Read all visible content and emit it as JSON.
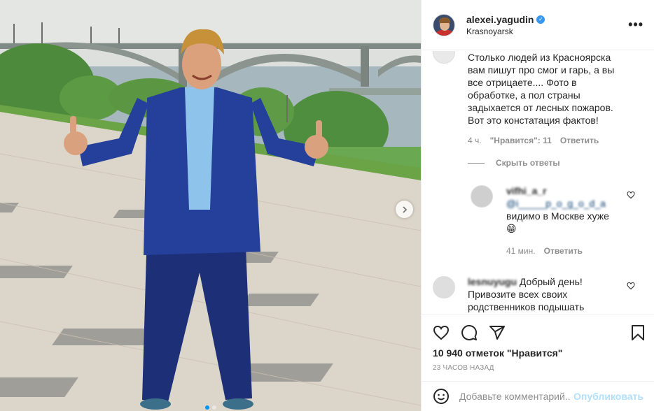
{
  "post": {
    "username": "alexei.yagudin",
    "location": "Krasnoyarsk",
    "more_icon": "more-horizontal-icon"
  },
  "comments": [
    {
      "text_lines": [
        "Столько людей из Красноярска",
        "вам пишут про смог и гарь, а вы",
        "все отрицаете.... Фото в",
        "обработке, а пол страны",
        "задыхается от лесных пожаров.",
        "Вот это констатация фактов!"
      ],
      "time": "4 ч.",
      "likes": "\"Нравится\": 11",
      "reply": "Ответить"
    }
  ],
  "hide_replies": "Скрыть ответы",
  "reply": {
    "username": "vifhi_a_r",
    "mention": "@i_____p_o_g_o_d_a",
    "text": "видимо в Москве хуже",
    "emoji": "😁",
    "time": "41 мин.",
    "reply_label": "Ответить"
  },
  "comment2": {
    "username": "lesnuyugu",
    "text_lines": [
      "Добрый день!",
      "Привозите всех своих",
      "родственников подышать"
    ]
  },
  "actions": {
    "like_icon": "heart-icon",
    "comment_icon": "comment-icon",
    "share_icon": "share-icon",
    "save_icon": "bookmark-icon"
  },
  "likes_text": "10 940 отметок \"Нравится\"",
  "time_ago": "23 ЧАСОВ НАЗАД",
  "comment_box": {
    "placeholder": "Добавьте комментарий...",
    "publish": "Опубликовать",
    "emoji_icon": "smile-icon"
  },
  "colors": {
    "accent": "#0095f6",
    "publish_disabled": "#b2dffc",
    "verified": "#3897f0",
    "suit": "#1f3a8c",
    "shirt": "#8ec3ec"
  }
}
